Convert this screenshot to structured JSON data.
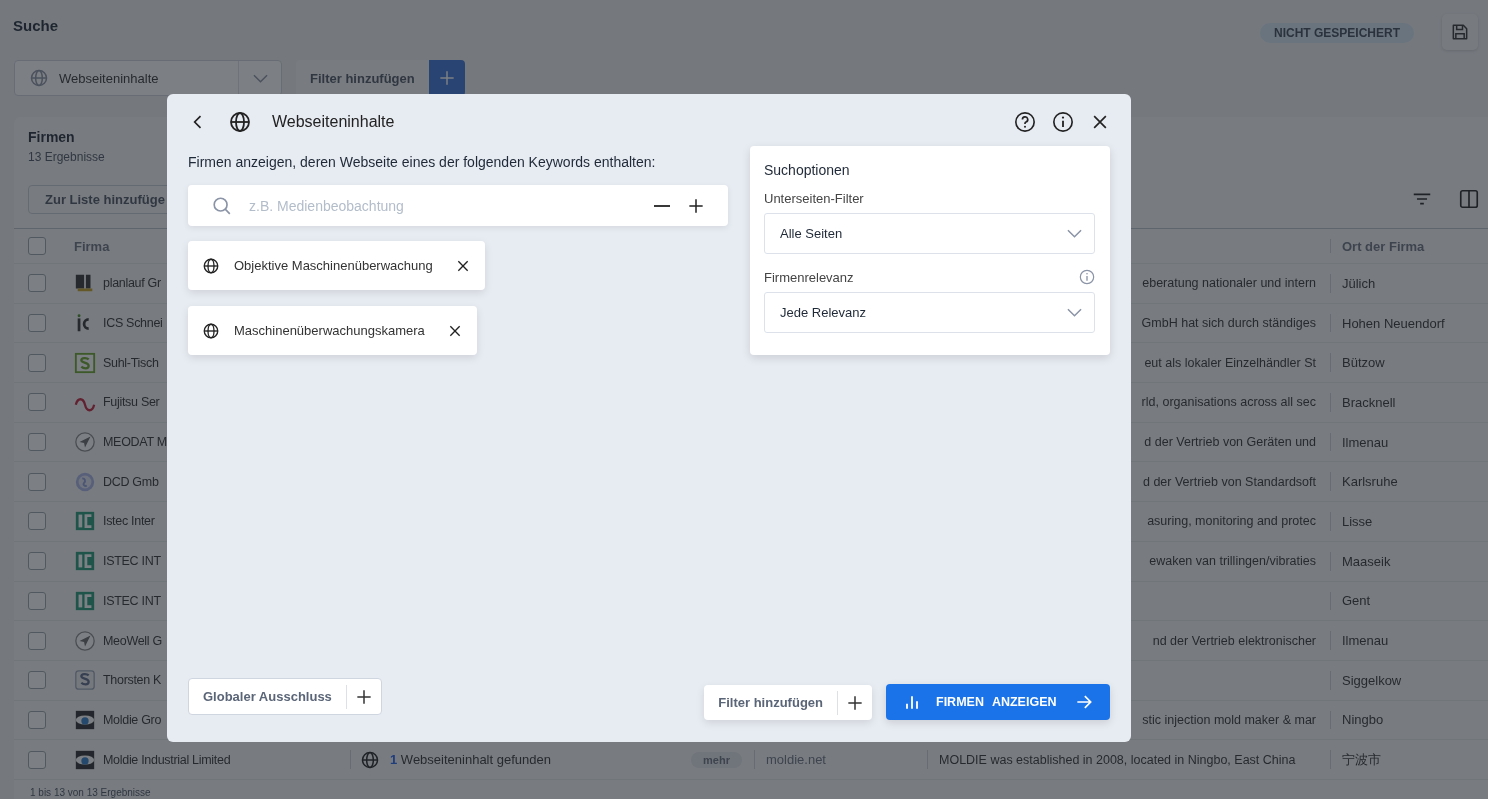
{
  "page": {
    "title": "Suche",
    "save_status": "NICHT GESPEICHERT"
  },
  "filter_bar": {
    "select_value": "Webseiteninhalte",
    "add_filter": "Filter hinzufügen"
  },
  "results": {
    "title": "Firmen",
    "count": "13 Ergebnisse",
    "add_to_list": "Zur Liste hinzufüge",
    "header_checked": false,
    "columns": [
      "Firma",
      "Ort der Firma"
    ],
    "rows": [
      {
        "checked": false,
        "kind": "blocks",
        "name": "planlauf Gr",
        "description": "eberatung nationaler und intern",
        "location": "Jülich"
      },
      {
        "checked": false,
        "kind": "bars",
        "name": "ICS Schnei",
        "description": "GmbH hat sich durch ständiges",
        "location": "Hohen Neuendorf"
      },
      {
        "checked": false,
        "kind": "green",
        "name": "Suhl-Tisch",
        "description": "eut als lokaler Einzelhändler St",
        "location": "Bützow"
      },
      {
        "checked": false,
        "kind": "loop",
        "name": "Fujitsu Ser",
        "description": "rld, organisations across all sec",
        "location": "Bracknell"
      },
      {
        "checked": false,
        "kind": "arrow",
        "name": "MEODAT M",
        "description": "d der Vertrieb von Geräten und",
        "location": "Ilmenau"
      },
      {
        "checked": false,
        "kind": "globe",
        "name": "DCD Gmb",
        "description": "d der Vertrieb von Standardsoft",
        "location": "Karlsruhe"
      },
      {
        "checked": false,
        "kind": "teal",
        "name": "Istec Inter",
        "description": "asuring, monitoring and protec",
        "location": "Lisse"
      },
      {
        "checked": false,
        "kind": "teal",
        "name": "ISTEC INT",
        "description": "ewaken van trillingen/vibraties",
        "location": "Maaseik"
      },
      {
        "checked": false,
        "kind": "teal",
        "name": "ISTEC INT",
        "location": "Gent"
      },
      {
        "checked": false,
        "kind": "arrow",
        "name": "MeoWell G",
        "description": "nd der Vertrieb elektronischer",
        "location": "Ilmenau"
      },
      {
        "checked": false,
        "kind": "grey",
        "name": "Thorsten K",
        "location": "Siggelkow"
      },
      {
        "checked": false,
        "kind": "lens",
        "name": "Moldie Gro",
        "description": "stic injection mold maker & mar",
        "location": "Ningbo"
      },
      {
        "checked": false,
        "kind": "lens",
        "name": "Moldie Industrial Limited",
        "content": "**1** Webseiteninhalt gefunden",
        "more": "mehr",
        "website": "moldie.net",
        "description": "MOLDIE was established in 2008, located in Ningbo, East China",
        "location": "宁波市"
      }
    ],
    "footer": "1 bis 13 von 13 Ergebnisse"
  },
  "modal": {
    "title": "Webseiteninhalte",
    "description": "Firmen anzeigen, deren Webseite eines der folgenden Keywords enthalten:",
    "search_placeholder": "z.B. Medienbeobachtung",
    "keywords": [
      "Objektive Maschinenüberwachung",
      "Maschinenüberwachungskamera"
    ],
    "options": {
      "title": "Suchoptionen",
      "fields": [
        {
          "label": "Unterseiten-Filter",
          "value": "Alle Seiten",
          "info": false
        },
        {
          "label": "Firmenrelevanz",
          "value": "Jede Relevanz",
          "info": true
        }
      ]
    },
    "exclusion_button": "Globaler Ausschluss",
    "add_filter_button": "Filter hinzufügen",
    "submit_button": "FIRMEN ANZEIGEN"
  }
}
